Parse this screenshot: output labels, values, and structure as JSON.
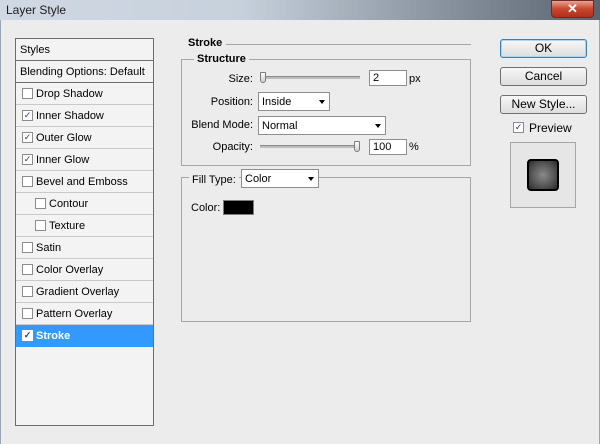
{
  "window": {
    "title": "Layer Style",
    "close_glyph": "✕"
  },
  "styles": {
    "header": "Styles",
    "blending": "Blending Options: Default",
    "items": [
      {
        "label": "Drop Shadow",
        "checked": false,
        "indent": false
      },
      {
        "label": "Inner Shadow",
        "checked": true,
        "indent": false
      },
      {
        "label": "Outer Glow",
        "checked": true,
        "indent": false
      },
      {
        "label": "Inner Glow",
        "checked": true,
        "indent": false
      },
      {
        "label": "Bevel and Emboss",
        "checked": false,
        "indent": false
      },
      {
        "label": "Contour",
        "checked": false,
        "indent": true
      },
      {
        "label": "Texture",
        "checked": false,
        "indent": true
      },
      {
        "label": "Satin",
        "checked": false,
        "indent": false
      },
      {
        "label": "Color Overlay",
        "checked": false,
        "indent": false
      },
      {
        "label": "Gradient Overlay",
        "checked": false,
        "indent": false
      },
      {
        "label": "Pattern Overlay",
        "checked": false,
        "indent": false
      },
      {
        "label": "Stroke",
        "checked": true,
        "indent": false,
        "selected": true
      }
    ]
  },
  "stroke": {
    "title": "Stroke",
    "structure_title": "Structure",
    "size_label": "Size:",
    "size_value": "2",
    "size_unit": "px",
    "size_fraction": 0.0,
    "position_label": "Position:",
    "position_value": "Inside",
    "blend_label": "Blend Mode:",
    "blend_value": "Normal",
    "opacity_label": "Opacity:",
    "opacity_value": "100",
    "opacity_unit": "%",
    "opacity_fraction": 1.0,
    "fill_type_label": "Fill Type:",
    "fill_type_value": "Color",
    "color_label": "Color:",
    "color_value": "#000000"
  },
  "buttons": {
    "ok": "OK",
    "cancel": "Cancel",
    "new_style": "New Style...",
    "preview_label": "Preview",
    "preview_checked": true
  },
  "check_glyph": "✓"
}
